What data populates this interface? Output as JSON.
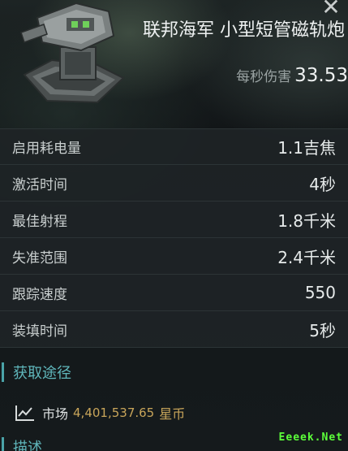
{
  "header": {
    "title": "联邦海军 小型短管磁轨炮",
    "dps_label": "每秒伤害",
    "dps_value": "33.53",
    "close_icon": "close-icon"
  },
  "stats": [
    {
      "label": "启用耗电量",
      "value": "1.1吉焦"
    },
    {
      "label": "激活时间",
      "value": "4秒"
    },
    {
      "label": "最佳射程",
      "value": "1.8千米"
    },
    {
      "label": "失准范围",
      "value": "2.4千米"
    },
    {
      "label": "跟踪速度",
      "value": "550"
    },
    {
      "label": "装填时间",
      "value": "5秒"
    }
  ],
  "acquire": {
    "title": "获取途径",
    "market_label": "市场",
    "market_price": "4,401,537.65",
    "market_unit": "星币",
    "icon": "line-chart-icon"
  },
  "description": {
    "title": "描述"
  },
  "watermark": "Eeeek.Net",
  "colors": {
    "accent": "#5fb6bb",
    "price": "#c8a55a",
    "watermark": "#5cff3a"
  }
}
